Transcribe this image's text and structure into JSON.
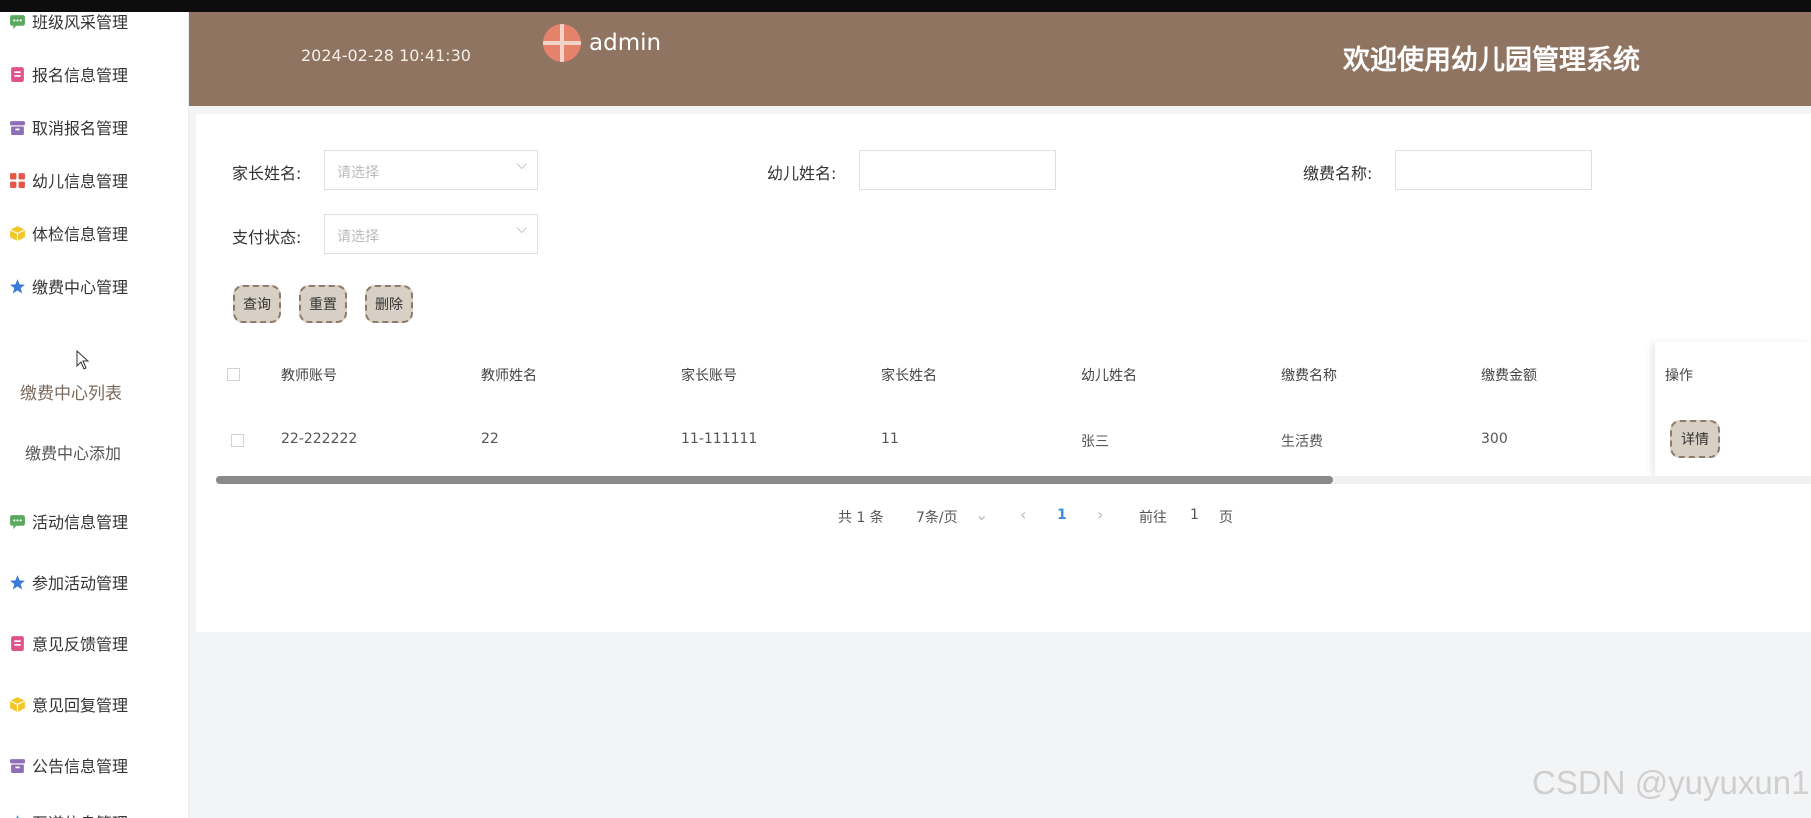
{
  "header": {
    "datetime": "2024-02-28 10:41:30",
    "username": "admin",
    "welcome": "欢迎使用幼儿园管理系统"
  },
  "sidebar": {
    "items": [
      {
        "label": "班级风采管理",
        "icon": "chat-icon",
        "color": "#5aa95f"
      },
      {
        "label": "报名信息管理",
        "icon": "document-icon",
        "color": "#e0528a"
      },
      {
        "label": "取消报名管理",
        "icon": "archive-icon",
        "color": "#8e6fb5"
      },
      {
        "label": "幼儿信息管理",
        "icon": "grid-icon",
        "color": "#e4584a"
      },
      {
        "label": "体检信息管理",
        "icon": "cube-icon",
        "color": "#f2c72a"
      },
      {
        "label": "缴费中心管理",
        "icon": "star-icon",
        "color": "#3a7bd5"
      },
      {
        "label": "活动信息管理",
        "icon": "chat-icon",
        "color": "#5aa95f"
      },
      {
        "label": "参加活动管理",
        "icon": "star-icon",
        "color": "#3a7bd5"
      },
      {
        "label": "意见反馈管理",
        "icon": "document-icon",
        "color": "#e0528a"
      },
      {
        "label": "意见回复管理",
        "icon": "cube-icon",
        "color": "#f2c72a"
      },
      {
        "label": "公告信息管理",
        "icon": "archive-icon",
        "color": "#8e6fb5"
      },
      {
        "label": "至道信息管理",
        "icon": "star-icon",
        "color": "#3a7bd5"
      }
    ],
    "subitems": [
      {
        "label": "缴费中心列表",
        "active": true
      },
      {
        "label": "缴费中心添加",
        "active": false
      }
    ]
  },
  "filters": {
    "parent_name_label": "家长姓名:",
    "parent_name_placeholder": "请选择",
    "child_name_label": "幼儿姓名:",
    "child_name_value": "",
    "fee_name_label": "缴费名称:",
    "fee_name_value": "",
    "pay_status_label": "支付状态:",
    "pay_status_placeholder": "请选择"
  },
  "actions": {
    "query": "查询",
    "reset": "重置",
    "delete": "删除"
  },
  "table": {
    "columns": [
      "教师账号",
      "教师姓名",
      "家长账号",
      "家长姓名",
      "幼儿姓名",
      "缴费名称",
      "缴费金额",
      "操作"
    ],
    "rows": [
      {
        "teacher_account": "22-222222",
        "teacher_name": "22",
        "parent_account": "11-111111",
        "parent_name": "11",
        "child_name": "张三",
        "fee_name": "生活费",
        "amount": "300",
        "action": "详情"
      }
    ],
    "scroll_fraction": 0.7
  },
  "pagination": {
    "total": "共 1 条",
    "page_size": "7条/页",
    "current": "1",
    "goto_label": "前往",
    "goto_value": "1",
    "page_unit": "页"
  },
  "watermark": "CSDN @yuyuxun1",
  "colors": {
    "header": "#8e7461",
    "button": "#d9d0c5",
    "button_border": "#8d7a68",
    "pagination_active": "#3a8ee6"
  }
}
